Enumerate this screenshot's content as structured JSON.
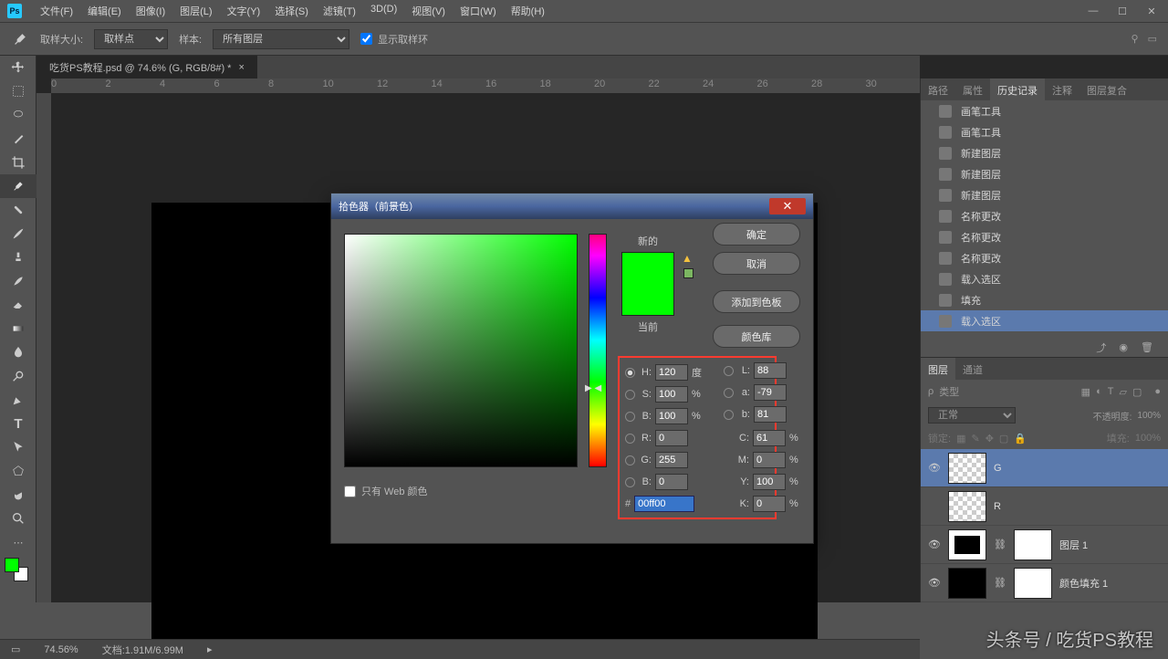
{
  "app": {
    "logo": "Ps"
  },
  "menu": [
    "文件(F)",
    "编辑(E)",
    "图像(I)",
    "图层(L)",
    "文字(Y)",
    "选择(S)",
    "滤镜(T)",
    "3D(D)",
    "视图(V)",
    "窗口(W)",
    "帮助(H)"
  ],
  "options": {
    "sample_label": "取样大小:",
    "sample_value": "取样点",
    "sample2_label": "样本:",
    "sample2_value": "所有图层",
    "show_ring": "显示取样环"
  },
  "doc_tab": "吃货PS教程.psd @ 74.6% (G, RGB/8#) *",
  "ruler_marks": [
    "0",
    "2",
    "4",
    "6",
    "8",
    "10",
    "12",
    "14",
    "16",
    "18",
    "20",
    "22",
    "24",
    "26",
    "28",
    "30"
  ],
  "panels": {
    "top_tabs": [
      "路径",
      "属性",
      "历史记录",
      "注释",
      "图层复合"
    ],
    "top_active": 2,
    "history": [
      "画笔工具",
      "画笔工具",
      "新建图层",
      "新建图层",
      "新建图层",
      "名称更改",
      "名称更改",
      "名称更改",
      "载入选区",
      "填充",
      "载入选区"
    ],
    "history_active": 10,
    "layer_tabs": [
      "图层",
      "通道"
    ],
    "layer_active": 0,
    "kind_label": "类型",
    "blend": "正常",
    "opacity_label": "不透明度:",
    "opacity_val": "100%",
    "lock_label": "锁定:",
    "fill_label": "填充:",
    "fill_val": "100%",
    "layers": [
      {
        "name": "G",
        "active": true,
        "thumb": "checker",
        "eye": true
      },
      {
        "name": "R",
        "active": false,
        "thumb": "checker",
        "eye": false
      },
      {
        "name": "图层 1",
        "active": false,
        "thumb": "custom",
        "eye": true,
        "mask": true
      },
      {
        "name": "颜色填充 1",
        "active": false,
        "thumb": "black",
        "eye": true,
        "mask": true
      }
    ]
  },
  "picker": {
    "title": "拾色器（前景色）",
    "new_label": "新的",
    "cur_label": "当前",
    "ok": "确定",
    "cancel": "取消",
    "add_swatch": "添加到色板",
    "color_lib": "颜色库",
    "web_only": "只有 Web 颜色",
    "hsv": {
      "H": "120",
      "S": "100",
      "B": "100",
      "H_u": "度",
      "p": "%"
    },
    "rgb": {
      "R": "0",
      "G": "255",
      "B": "0"
    },
    "lab": {
      "L": "88",
      "a": "-79",
      "b": "81"
    },
    "cmyk": {
      "C": "61",
      "M": "0",
      "Y": "100",
      "K": "0",
      "p": "%"
    },
    "hex_label": "#",
    "hex": "00ff00"
  },
  "status": {
    "zoom": "74.56%",
    "doc_size": "文档:1.91M/6.99M"
  },
  "watermark": "头条号 / 吃货PS教程"
}
